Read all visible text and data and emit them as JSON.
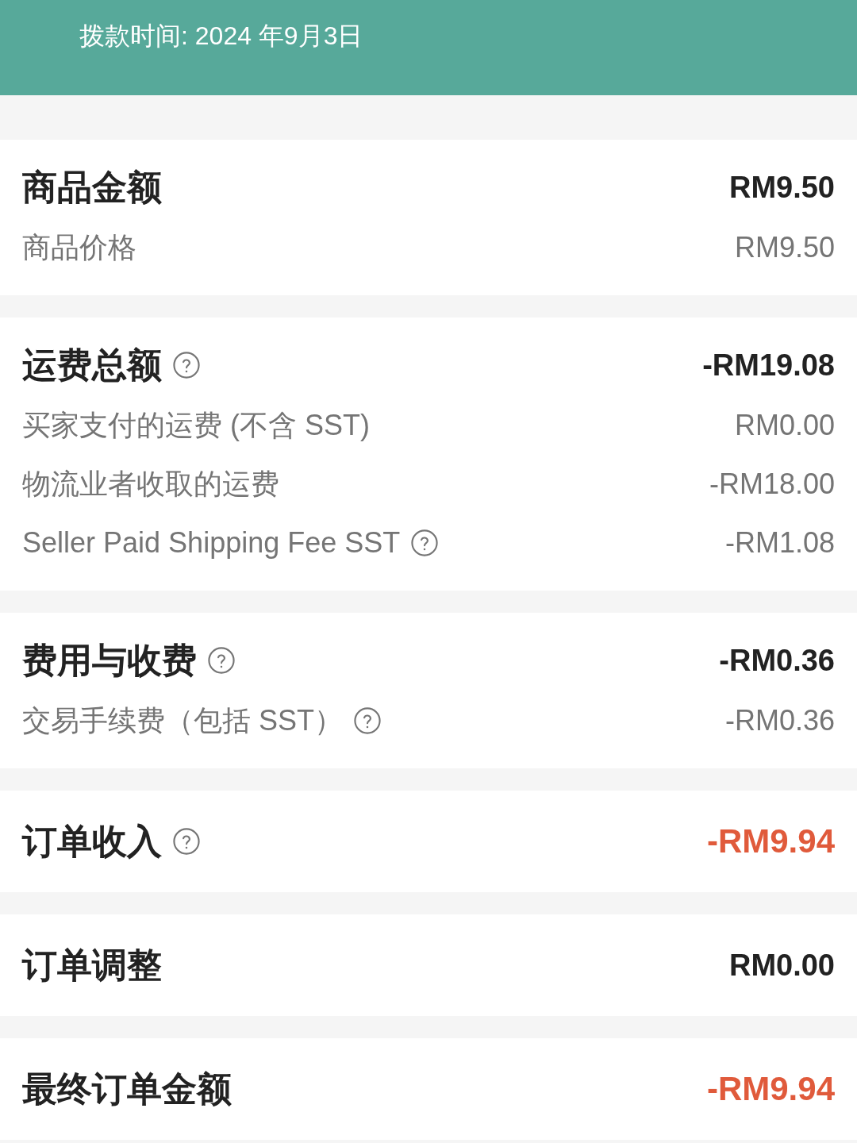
{
  "header": {
    "payout_date": "拨款时间: 2024 年9月3日"
  },
  "sections": [
    {
      "title": "商品金额",
      "help": false,
      "amount": "RM9.50",
      "highlighted": false,
      "rows": [
        {
          "label": "商品价格",
          "help": false,
          "amount": "RM9.50"
        }
      ]
    },
    {
      "title": "运费总额",
      "help": true,
      "amount": "-RM19.08",
      "highlighted": false,
      "rows": [
        {
          "label": "买家支付的运费 (不含 SST)",
          "help": false,
          "amount": "RM0.00"
        },
        {
          "label": "物流业者收取的运费",
          "help": false,
          "amount": "-RM18.00"
        },
        {
          "label": "Seller Paid Shipping Fee SST",
          "help": true,
          "amount": "-RM1.08"
        }
      ]
    },
    {
      "title": "费用与收费",
      "help": true,
      "amount": "-RM0.36",
      "highlighted": false,
      "rows": [
        {
          "label": "交易手续费（包括 SST）",
          "help": true,
          "amount": "-RM0.36"
        }
      ]
    },
    {
      "title": "订单收入",
      "help": true,
      "amount": "-RM9.94",
      "highlighted": true
    },
    {
      "title": "订单调整",
      "help": false,
      "amount": "RM0.00",
      "highlighted": false
    },
    {
      "title": "最终订单金额",
      "help": false,
      "amount": "-RM9.94",
      "highlighted": true
    }
  ]
}
